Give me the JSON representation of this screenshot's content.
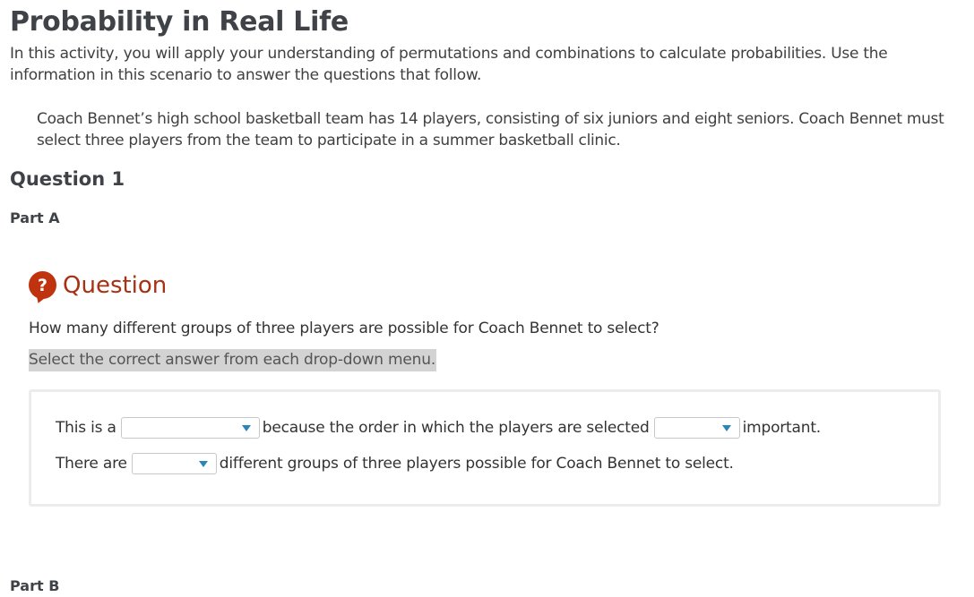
{
  "page": {
    "title": "Probability in Real Life",
    "intro": "In this activity, you will apply your understanding of permutations and combinations to calculate probabilities. Use the information in this scenario to answer the questions that follow.",
    "scenario": "Coach Bennet’s high school basketball team has 14 players, consisting of six juniors and eight seniors. Coach Bennet must select three players from the team to participate in a summer basketball clinic."
  },
  "question1": {
    "heading": "Question 1",
    "part_a": "Part A",
    "label": "Question",
    "icon": "question-mark-icon",
    "text": "How many different groups of three players are possible for Coach Bennet to select?",
    "instruction": "Select the correct answer from each drop-down menu.",
    "line1": {
      "before": "This is a",
      "middle": "because the order in which the players are selected",
      "after": "important."
    },
    "line2": {
      "before": "There are",
      "after": "different groups of three players possible for Coach Bennet to select."
    }
  },
  "part_b": "Part B",
  "colors": {
    "accent_red": "#c0330f",
    "caret_blue": "#2a86b8",
    "highlight_gray": "#d3d3d3"
  }
}
